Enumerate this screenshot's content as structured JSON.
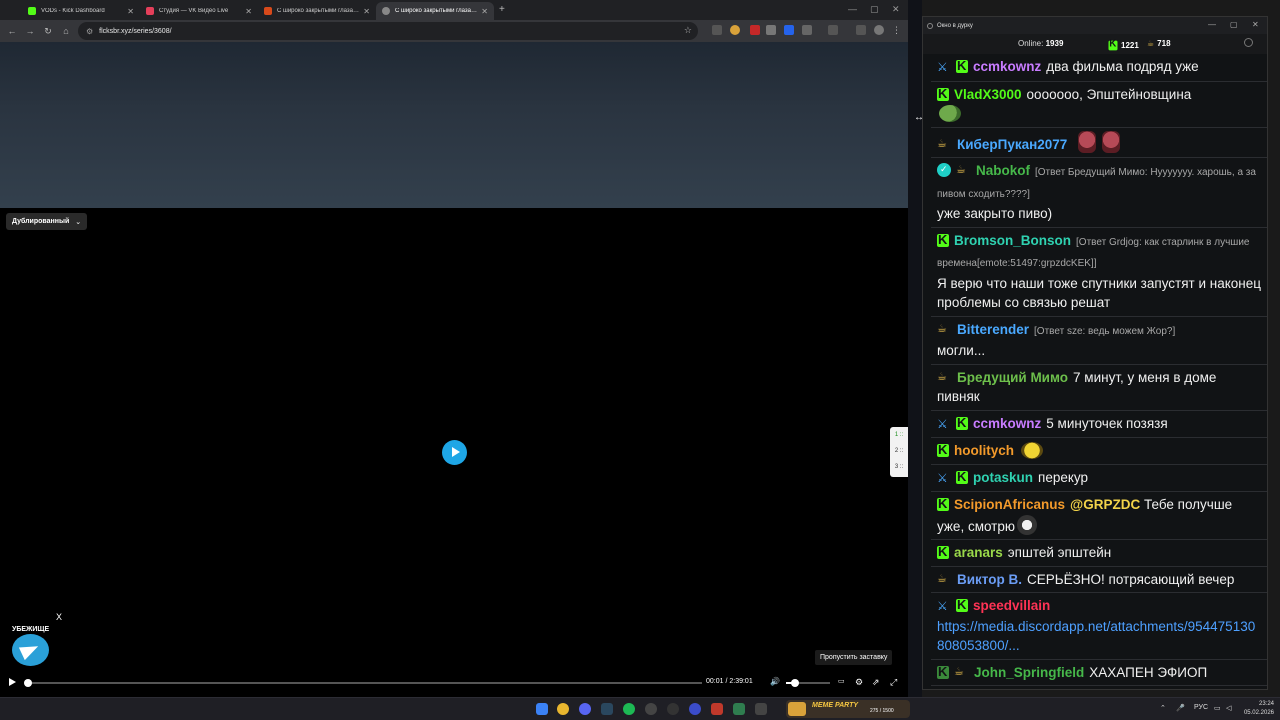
{
  "browser": {
    "tabs": [
      {
        "title": "VODs - Kick Dashboard",
        "favicon_color": "#53fc18",
        "active": false
      },
      {
        "title": "Студия — VK Видео Live",
        "favicon_color": "#e43f5a",
        "active": false
      },
      {
        "title": "С широко закрытыми глазами",
        "favicon_color": "#d84a1b",
        "active": false
      },
      {
        "title": "С широко закрытыми глазами",
        "favicon_color": "#888888",
        "active": true
      }
    ],
    "url": "flcksbr.xyz/series/3608/"
  },
  "player": {
    "dub_label": "Дублированный",
    "quality_options": [
      "1 ::",
      "2 ::",
      "3 ::"
    ],
    "telegram_close": "X",
    "telegram_label": "УБЕЖИЩЕ",
    "skip_intro": "Пропустить заставку",
    "time": "00:01 / 2:39:01",
    "progress": 0.0001,
    "volume": 0.25
  },
  "chat": {
    "window_title": "Окно в дурку",
    "online_label": "Online:",
    "online_count": "1939",
    "kick_count": "1221",
    "vk_count": "718",
    "messages": [
      {
        "badges": [
          "sword",
          "kick"
        ],
        "user": "ccmkownz",
        "color": "#c87cff",
        "text": "два фильма подряд уже"
      },
      {
        "badges": [
          "kick"
        ],
        "user": "VladX3000",
        "color": "#53fc18",
        "text": "ooooooo, Эпштейновщина",
        "emote": "pepe"
      },
      {
        "badges": [
          "chef"
        ],
        "user": "КиберПукан2077",
        "color": "#4aa9ff",
        "text": "",
        "emote": "red2"
      },
      {
        "badges": [
          "verified",
          "chef"
        ],
        "user": "Nabokof",
        "color": "#46b84a",
        "reply": "[Ответ Бредущий Мимо: Нууууууу. харошь, а за пивом сходить????]",
        "text": "уже закрыто пиво)"
      },
      {
        "badges": [
          "kick"
        ],
        "user": "Bromson_Bonson",
        "color": "#2fd2b1",
        "reply": "[Ответ Grdjog: как старлинк в лучшие времена[emote:51497:grpzdcKEK]]",
        "text": "Я верю что наши тоже спутники запустят и наконец проблемы со связью решат"
      },
      {
        "badges": [
          "chef"
        ],
        "user": "Bitterender",
        "color": "#4aa9ff",
        "reply": "[Ответ sze: ведь можем Жор?]",
        "text": "могли..."
      },
      {
        "badges": [
          "chef"
        ],
        "user": "Бредущий Мимо",
        "color": "#6dbf4b",
        "text": "7 минут, у меня в доме пивняк"
      },
      {
        "badges": [
          "sword",
          "kick"
        ],
        "user": "ccmkownz",
        "color": "#c87cff",
        "text": "5 минуточек позязя"
      },
      {
        "badges": [
          "kick"
        ],
        "user": "hoolitych",
        "color": "#f39a2b",
        "text": "",
        "emote": "yellow"
      },
      {
        "badges": [
          "sword",
          "kick"
        ],
        "user": "potaskun",
        "color": "#2fd2b1",
        "text": "перекур"
      },
      {
        "badges": [
          "kick"
        ],
        "user": "ScipionAfricanus",
        "color": "#f39a2b",
        "mention": "@GRPZDC",
        "text": "Тебе получше уже, смотрю",
        "emote": "cat"
      },
      {
        "badges": [
          "kick"
        ],
        "user": "aranars",
        "color": "#9ad94a",
        "text": "эпштей эпштейн"
      },
      {
        "badges": [
          "chef"
        ],
        "user": "Виктор В.",
        "color": "#6b9df5",
        "text": "СЕРЬЁЗНО! потрясающий вечер"
      },
      {
        "badges": [
          "sword",
          "kick"
        ],
        "user": "speedvillain",
        "color": "#ff3355",
        "link": "https://media.discordapp.net/attachments/954475130808053800/...",
        "text": ""
      },
      {
        "badges": [
          "check",
          "chef"
        ],
        "user": "John_Springfield",
        "color": "#46b84a",
        "text": "ХАХАПЕН ЭФИОП"
      }
    ]
  },
  "taskbar": {
    "widget_title": "MEME PARTY",
    "widget_count": "275 / 1500",
    "lang": "РУС",
    "time": "23:24",
    "date": "05.02.2026"
  }
}
